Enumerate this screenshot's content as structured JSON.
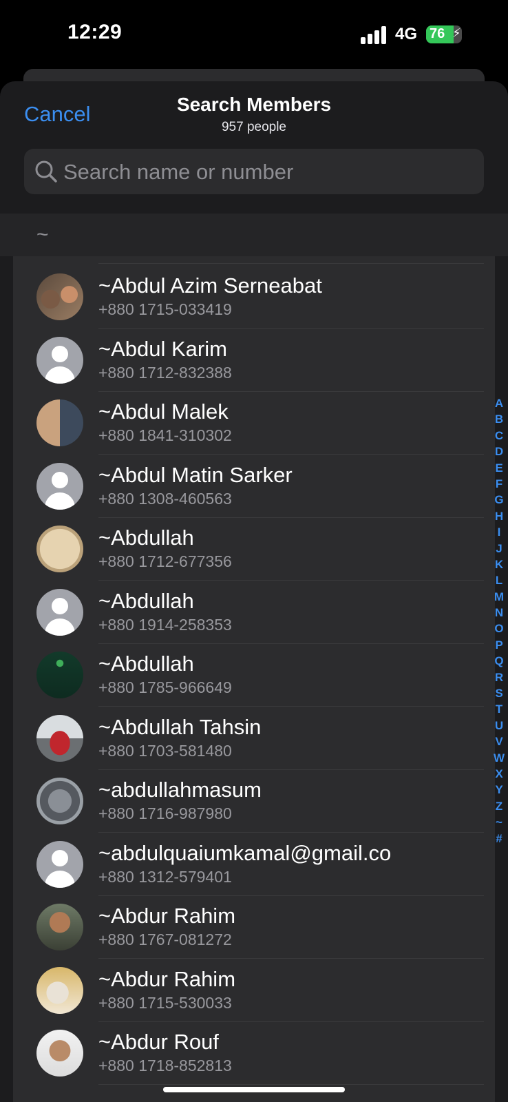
{
  "status_bar": {
    "time": "12:29",
    "network": "4G",
    "battery": "76",
    "battery_level": 0.76
  },
  "header": {
    "cancel": "Cancel",
    "title": "Search Members",
    "subtitle": "957 people"
  },
  "search": {
    "placeholder": "Search name or number"
  },
  "section": {
    "label": "~"
  },
  "members": [
    {
      "name": "~Abdul Azim Serneabat",
      "phone": "+880 1715-033419",
      "avatar": "photo"
    },
    {
      "name": "~Abdul Karim",
      "phone": "+880 1712-832388",
      "avatar": "default"
    },
    {
      "name": "~Abdul Malek",
      "phone": "+880 1841-310302",
      "avatar": "photo"
    },
    {
      "name": "~Abdul Matin Sarker",
      "phone": "+880 1308-460563",
      "avatar": "default"
    },
    {
      "name": "~Abdullah",
      "phone": "+880 1712-677356",
      "avatar": "photo"
    },
    {
      "name": "~Abdullah",
      "phone": "+880 1914-258353",
      "avatar": "default"
    },
    {
      "name": "~Abdullah",
      "phone": "+880 1785-966649",
      "avatar": "photo"
    },
    {
      "name": "~Abdullah Tahsin",
      "phone": "+880 1703-581480",
      "avatar": "photo"
    },
    {
      "name": "~abdullahmasum",
      "phone": "+880 1716-987980",
      "avatar": "photo"
    },
    {
      "name": "~abdulquaiumkamal@gmail.co",
      "phone": "+880 1312-579401",
      "avatar": "default"
    },
    {
      "name": "~Abdur Rahim",
      "phone": "+880 1767-081272",
      "avatar": "photo"
    },
    {
      "name": "~Abdur Rahim",
      "phone": "+880 1715-530033",
      "avatar": "photo"
    },
    {
      "name": "~Abdur Rouf",
      "phone": "+880 1718-852813",
      "avatar": "photo"
    }
  ],
  "index_letters": [
    "A",
    "B",
    "C",
    "D",
    "E",
    "F",
    "G",
    "H",
    "I",
    "J",
    "K",
    "L",
    "M",
    "N",
    "O",
    "P",
    "Q",
    "R",
    "S",
    "T",
    "U",
    "V",
    "W",
    "X",
    "Y",
    "Z",
    "~",
    "#"
  ],
  "colors": {
    "accent": "#3b8ef0",
    "background": "#1c1c1e",
    "row_background": "#2c2c2e",
    "secondary_text": "#98989d"
  }
}
